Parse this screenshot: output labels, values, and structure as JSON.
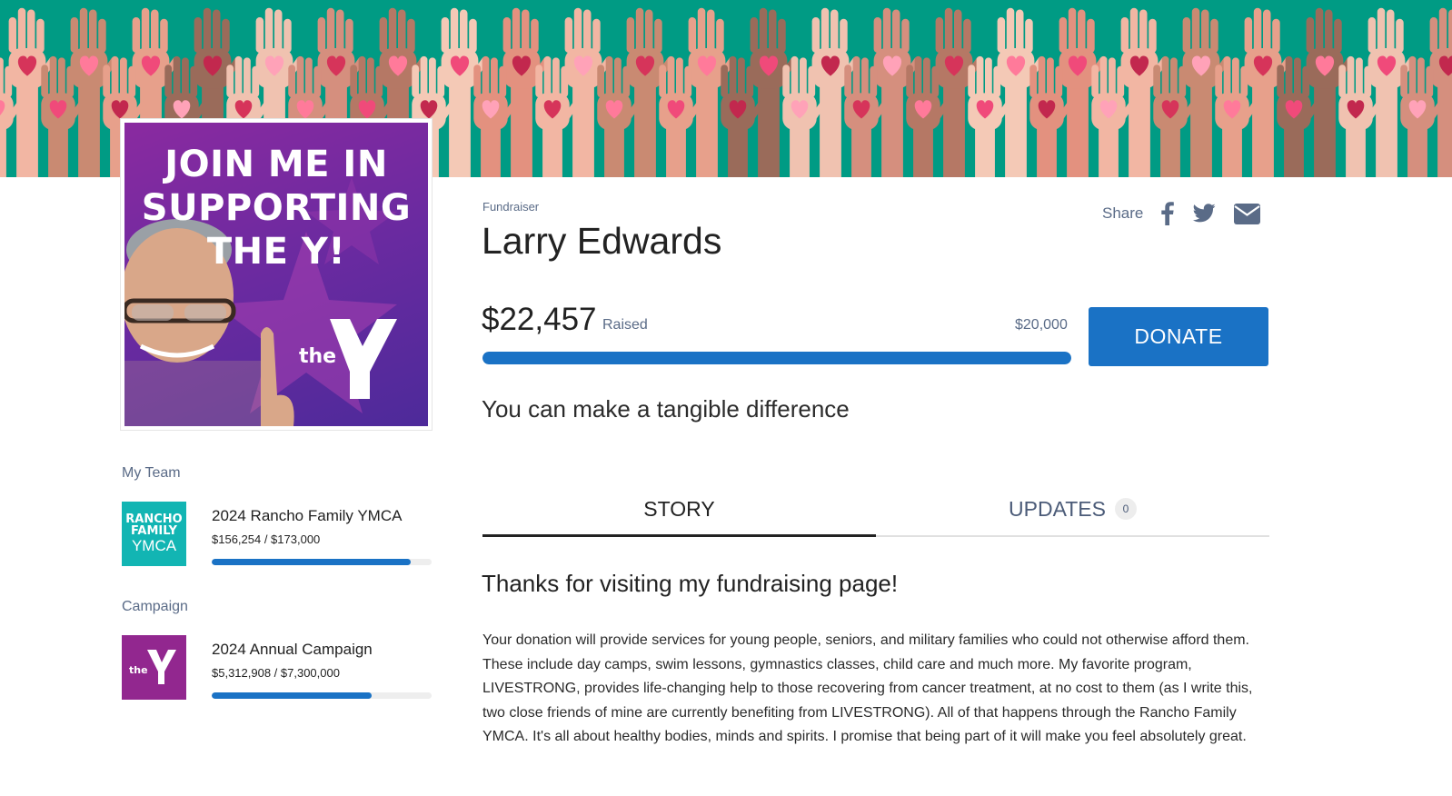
{
  "banner": {
    "background_color": "#009b84",
    "icon": "raised-hands-hearts-illustration"
  },
  "profile": {
    "photo_text": "JOIN ME IN SUPPORTING THE Y!",
    "photo_text_lines": [
      "JOIN ME IN",
      "SUPPORTING",
      "THE Y!"
    ],
    "logo_text": "the"
  },
  "sidebar": {
    "team_heading": "My Team",
    "team": {
      "logo_lines": [
        "RANCHO",
        "FAMILY",
        "YMCA"
      ],
      "logo_color": "#12b5b3",
      "name": "2024 Rancho Family YMCA",
      "amount": "$156,254 / $173,000",
      "progress": 0.903
    },
    "campaign_heading": "Campaign",
    "campaign": {
      "logo_text": "the",
      "logo_color": "#92278f",
      "name": "2024 Annual Campaign",
      "amount": "$5,312,908 / $7,300,000",
      "progress": 0.728
    }
  },
  "fundraiser": {
    "label": "Fundraiser",
    "name": "Larry Edwards",
    "share_label": "Share",
    "share_icons": [
      "facebook-icon",
      "twitter-icon",
      "email-icon"
    ],
    "raised_amount": "$22,457",
    "raised_label": "Raised",
    "goal": "$20,000",
    "progress": 1.0,
    "donate_label": "DONATE",
    "accent_color": "#1a72c5",
    "tagline": "You can make a tangible difference"
  },
  "tabs": {
    "story_label": "STORY",
    "updates_label": "UPDATES",
    "updates_count": "0"
  },
  "story": {
    "title": "Thanks for visiting my fundraising page!",
    "body": "Your donation will provide services for young people, seniors, and military families who could not otherwise afford them. These include day camps, swim lessons, gymnastics classes, child care and much more. My favorite program, LIVESTRONG, provides life-changing help to those recovering from cancer treatment, at no cost to them (as I write this, two close friends of mine are currently benefiting from LIVESTRONG). All of that happens through the Rancho Family YMCA. It's all about healthy bodies, minds and spirits. I promise that being part of it will make you feel absolutely great."
  }
}
